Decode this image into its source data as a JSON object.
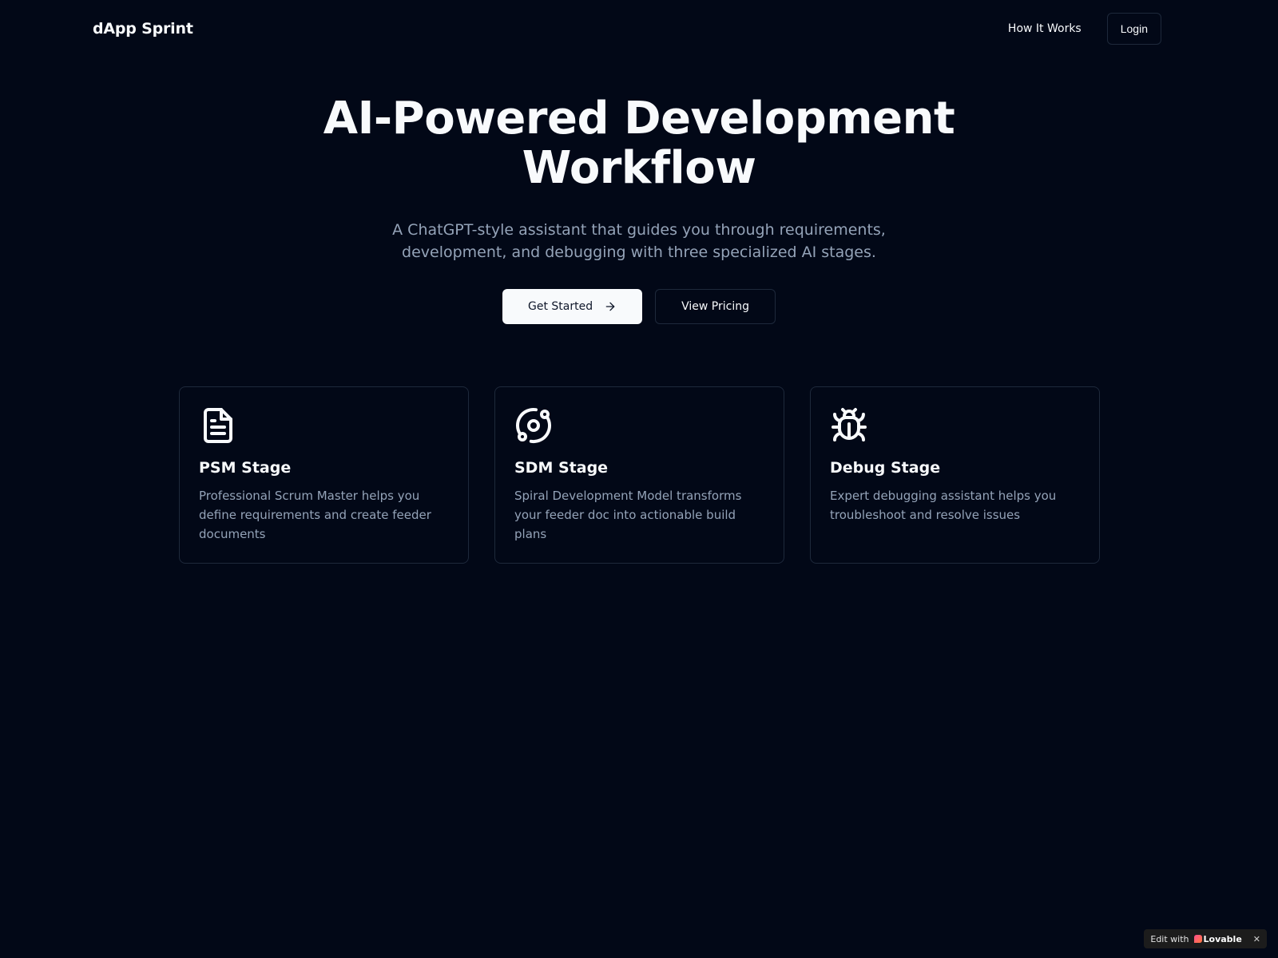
{
  "header": {
    "brand": "dApp Sprint",
    "nav_how_it_works": "How It Works",
    "nav_login": "Login"
  },
  "hero": {
    "title_line1": "AI-Powered Development",
    "title_line2": "Workflow",
    "subtitle": "A ChatGPT-style assistant that guides you through requirements, development, and debugging with three specialized AI stages.",
    "primary_cta": "Get Started",
    "secondary_cta": "View Pricing"
  },
  "cards": [
    {
      "icon": "document-icon",
      "title": "PSM Stage",
      "description": "Professional Scrum Master helps you define requirements and create feeder documents"
    },
    {
      "icon": "orbit-icon",
      "title": "SDM Stage",
      "description": "Spiral Development Model transforms your feeder doc into actionable build plans"
    },
    {
      "icon": "bug-icon",
      "title": "Debug Stage",
      "description": "Expert debugging assistant helps you troubleshoot and resolve issues"
    }
  ],
  "badge": {
    "label": "Edit with",
    "logo_text": "Lovable",
    "close": "✕"
  },
  "colors": {
    "background": "#020817",
    "foreground": "#f8fafc",
    "muted": "#94a3b8",
    "border": "#1e293b"
  }
}
